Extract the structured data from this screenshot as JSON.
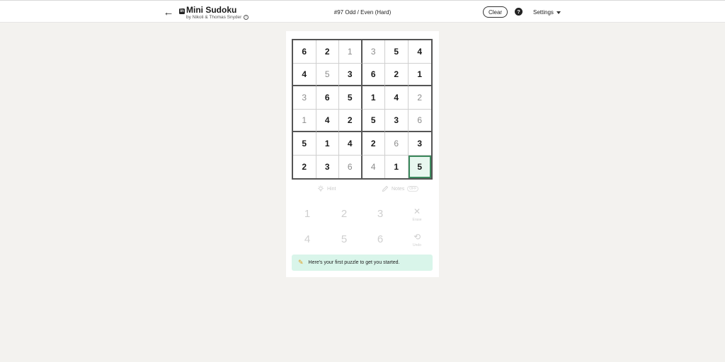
{
  "header": {
    "back_icon": "arrow-left-icon",
    "app_title": "Mini Sudoku",
    "byline": "by Nikoli & Thomas Snyder",
    "puzzle_title": "#97 Odd / Even (Hard)",
    "clear_label": "Clear",
    "help_icon": "?",
    "settings_label": "Settings"
  },
  "grid": {
    "size": 6,
    "rows": [
      [
        {
          "v": "6",
          "t": "given"
        },
        {
          "v": "2",
          "t": "given"
        },
        {
          "v": "1",
          "t": "entered"
        },
        {
          "v": "3",
          "t": "entered"
        },
        {
          "v": "5",
          "t": "given"
        },
        {
          "v": "4",
          "t": "given"
        }
      ],
      [
        {
          "v": "4",
          "t": "given"
        },
        {
          "v": "5",
          "t": "entered"
        },
        {
          "v": "3",
          "t": "given"
        },
        {
          "v": "6",
          "t": "given"
        },
        {
          "v": "2",
          "t": "given"
        },
        {
          "v": "1",
          "t": "given"
        }
      ],
      [
        {
          "v": "3",
          "t": "entered"
        },
        {
          "v": "6",
          "t": "given"
        },
        {
          "v": "5",
          "t": "given"
        },
        {
          "v": "1",
          "t": "given"
        },
        {
          "v": "4",
          "t": "given"
        },
        {
          "v": "2",
          "t": "entered"
        }
      ],
      [
        {
          "v": "1",
          "t": "entered"
        },
        {
          "v": "4",
          "t": "given"
        },
        {
          "v": "2",
          "t": "given"
        },
        {
          "v": "5",
          "t": "given"
        },
        {
          "v": "3",
          "t": "given"
        },
        {
          "v": "6",
          "t": "entered"
        }
      ],
      [
        {
          "v": "5",
          "t": "given"
        },
        {
          "v": "1",
          "t": "given"
        },
        {
          "v": "4",
          "t": "given"
        },
        {
          "v": "2",
          "t": "given"
        },
        {
          "v": "6",
          "t": "entered"
        },
        {
          "v": "3",
          "t": "given"
        }
      ],
      [
        {
          "v": "2",
          "t": "given"
        },
        {
          "v": "3",
          "t": "given"
        },
        {
          "v": "6",
          "t": "entered"
        },
        {
          "v": "4",
          "t": "entered"
        },
        {
          "v": "1",
          "t": "given"
        },
        {
          "v": "5",
          "t": "given",
          "selected": true
        }
      ]
    ]
  },
  "tools": {
    "hint_label": "Hint",
    "notes_label": "Notes",
    "notes_state": "OFF"
  },
  "numpad": {
    "row1": [
      "1",
      "2",
      "3"
    ],
    "row2": [
      "4",
      "5",
      "6"
    ],
    "erase_label": "Erase",
    "undo_label": "Undo"
  },
  "banner": {
    "text": "Here's your first puzzle to get you started."
  },
  "colors": {
    "selected_border": "#3d8a5e",
    "selected_fill": "#e8f7ef",
    "banner_bg": "#d9f5ea"
  }
}
